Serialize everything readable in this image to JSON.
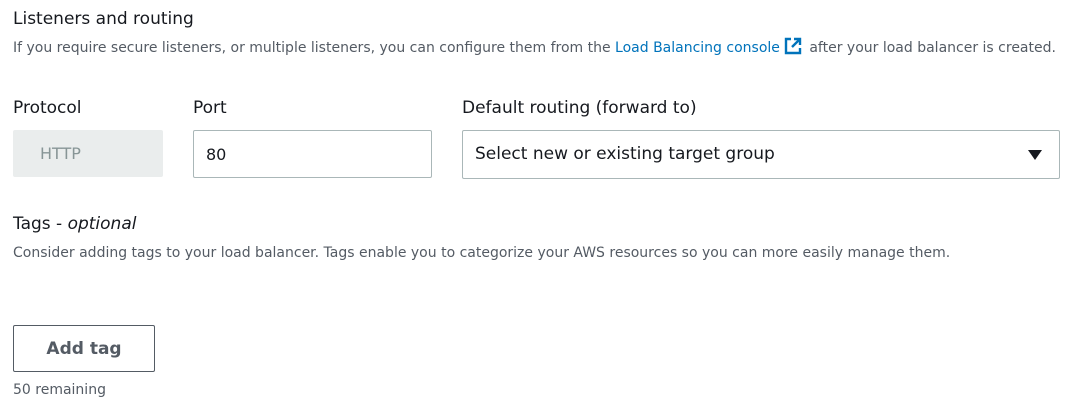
{
  "listeners": {
    "title": "Listeners and routing",
    "description_before_link": "If you require secure listeners, or multiple listeners, you can configure them from the ",
    "link_text": "Load Balancing console",
    "description_after_link": " after your load balancer is created.",
    "icons": {
      "external_link": "external-link-icon"
    },
    "protocol": {
      "label": "Protocol",
      "value": "HTTP"
    },
    "port": {
      "label": "Port",
      "value": "80"
    },
    "routing": {
      "label": "Default routing (forward to)",
      "selected": "Select new or existing target group",
      "caret_icon": "caret-down-icon"
    }
  },
  "tags": {
    "title": "Tags - ",
    "title_optional": "optional",
    "description": "Consider adding tags to your load balancer. Tags enable you to categorize your AWS resources so you can more easily manage them.",
    "add_button": "Add tag",
    "remaining": "50 remaining"
  },
  "colors": {
    "link": "#0073bb",
    "text": "#16191f",
    "secondary_text": "#545b64",
    "disabled_bg": "#eaeded",
    "disabled_text": "#879596",
    "border": "#aab7b8"
  }
}
